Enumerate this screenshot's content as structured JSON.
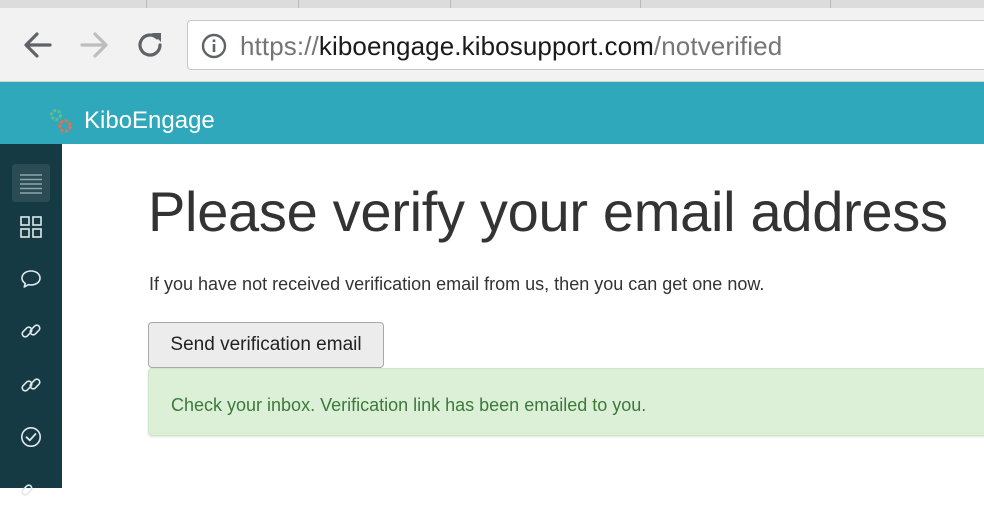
{
  "browser": {
    "url_scheme": "https://",
    "url_host": "kiboengage.kibosupport.com",
    "url_path": "/notverified",
    "icons": {
      "back": "arrow-left-icon",
      "forward": "arrow-right-icon",
      "reload": "reload-icon",
      "site_info": "info-icon"
    }
  },
  "app": {
    "name": "KiboEngage",
    "header_color": "#2fa8bc",
    "sidebar_color": "#163a44"
  },
  "sidebar": {
    "items": [
      {
        "icon": "hamburger-menu-icon"
      },
      {
        "icon": "grid-icon"
      },
      {
        "icon": "chat-bubble-icon"
      },
      {
        "icon": "link-icon"
      },
      {
        "icon": "link-icon"
      },
      {
        "icon": "check-circle-icon"
      },
      {
        "icon": "link-icon"
      }
    ]
  },
  "main": {
    "title": "Please verify your email address",
    "description": "If you have not received verification email from us, then you can get one now.",
    "send_button_label": "Send verification email",
    "alert_text": "Check your inbox. Verification link has been emailed to you.",
    "alert_color": "#dcefd7"
  }
}
